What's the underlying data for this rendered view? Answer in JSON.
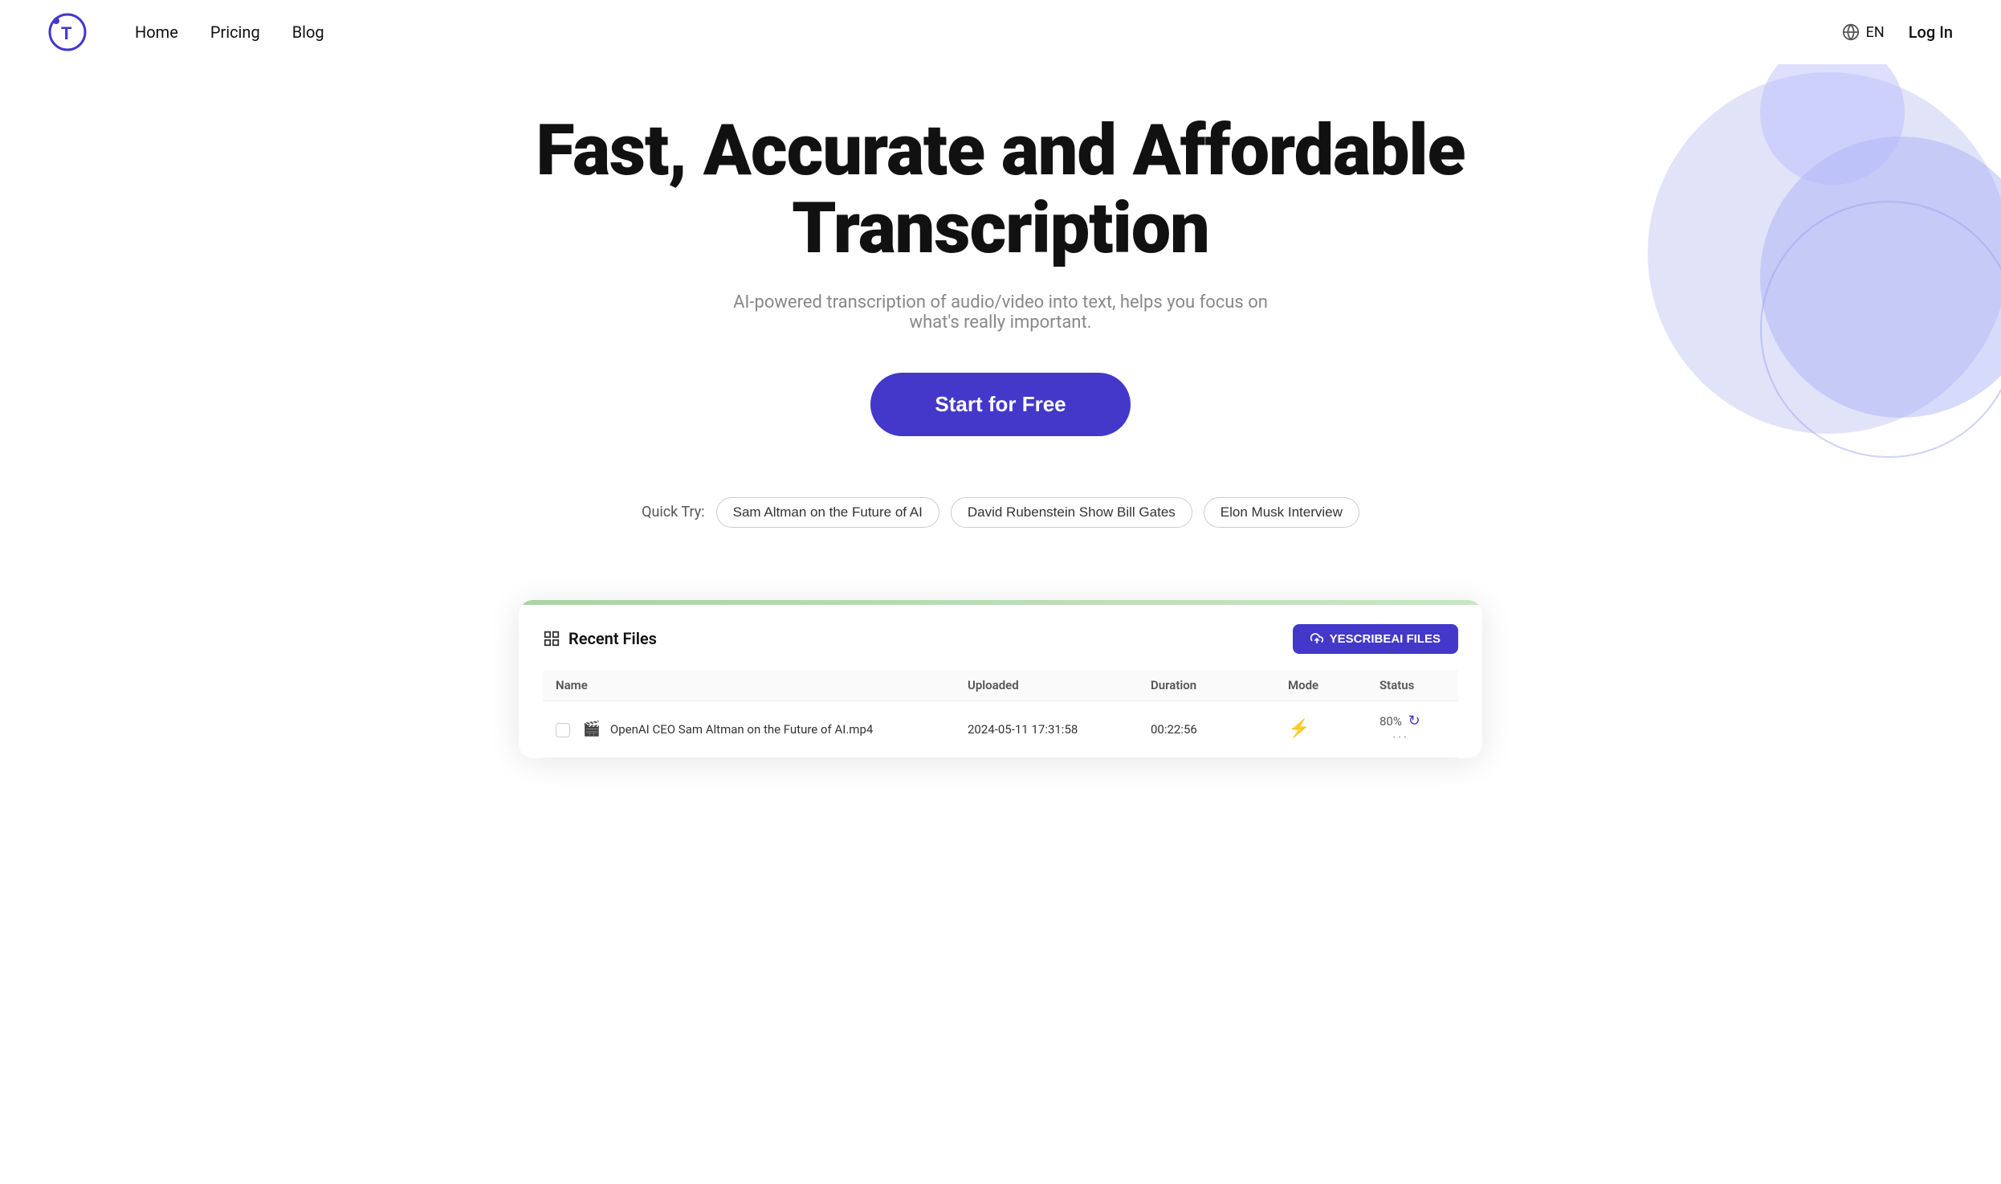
{
  "brand": {
    "name": "T",
    "logo_color": "#4338ca"
  },
  "navbar": {
    "links": [
      {
        "label": "Home",
        "id": "home"
      },
      {
        "label": "Pricing",
        "id": "pricing"
      },
      {
        "label": "Blog",
        "id": "blog"
      }
    ],
    "language": "EN",
    "login_label": "Log In"
  },
  "hero": {
    "title": "Fast, Accurate and Affordable Transcription",
    "subtitle": "AI-powered transcription of audio/video into text, helps you focus on what's really important.",
    "cta_label": "Start for Free",
    "quick_try_label": "Quick Try:",
    "quick_chips": [
      "Sam Altman on the Future of AI",
      "David Rubenstein Show Bill Gates",
      "Elon Musk Interview"
    ]
  },
  "dashboard": {
    "recent_files_label": "Recent Files",
    "upload_button_label": "YESCRIBEAI FILES",
    "table": {
      "headers": [
        "Name",
        "Uploaded",
        "Duration",
        "Mode",
        "Status"
      ],
      "rows": [
        {
          "name": "OpenAI CEO Sam Altman on the Future of AI.mp4",
          "uploaded": "2024-05-11 17:31:58",
          "duration": "00:22:56",
          "mode": "⚡",
          "status": "80%",
          "status_icon": "⟳"
        }
      ]
    }
  }
}
